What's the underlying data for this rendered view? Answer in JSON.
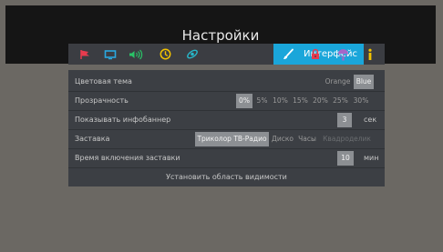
{
  "header": {
    "title": "Настройки"
  },
  "tabs": [
    {
      "icon": "flag-icon",
      "color": "#e83b4e"
    },
    {
      "icon": "tv-icon",
      "color": "#2aa8e0"
    },
    {
      "icon": "sound-icon",
      "color": "#29c467"
    },
    {
      "icon": "clock-icon",
      "color": "#f2c200"
    },
    {
      "icon": "satellite-icon",
      "color": "#27b7c9"
    },
    {
      "icon": "brush-icon",
      "label": "Интерфейс",
      "active": true,
      "color": "#1aa6da"
    },
    {
      "icon": "lock-icon",
      "color": "#e83b4e"
    },
    {
      "icon": "parachute-icon",
      "color": "#a766c8"
    },
    {
      "icon": "info-icon",
      "color": "#f2c200"
    }
  ],
  "settings": {
    "theme": {
      "label": "Цветовая тема",
      "options": [
        "Orange",
        "Blue"
      ],
      "selected": "Blue"
    },
    "transparency": {
      "label": "Прозрачность",
      "options": [
        "0%",
        "5%",
        "10%",
        "15%",
        "20%",
        "25%",
        "30%"
      ],
      "selected": "0%"
    },
    "infobanner": {
      "label": "Показывать инфобаннер",
      "value": "3",
      "unit": "сек"
    },
    "screensaver": {
      "label": "Заставка",
      "options": [
        "Триколор ТВ-Радио",
        "Диско",
        "Часы",
        "Квадроделик"
      ],
      "selected": "Триколор ТВ-Радио"
    },
    "screensaver_time": {
      "label": "Время включения заставки",
      "value": "10",
      "unit": "мин"
    },
    "visible_area": {
      "label": "Установить область видимости"
    }
  }
}
